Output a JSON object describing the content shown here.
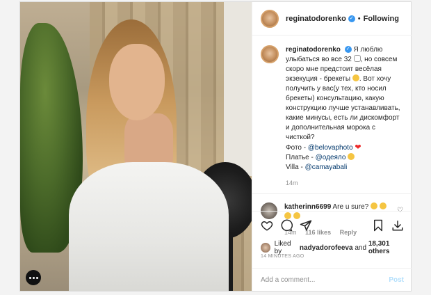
{
  "post": {
    "username": "reginatodorenko",
    "follow_label": "Following",
    "separator": "•",
    "caption": {
      "line1": "Я люблю улыбаться во все 32",
      "line2": ", но совсем скоро мне предстоит весёлая экзекуция - брекеты",
      "line3": ". Вот хочу получить у вас(у тех, кто носил брекеты) консультацию, какую конструкцию лучше устанавливать, какие минусы, есть ли дискомфорт и дополнительная морока с чисткой?",
      "photo_label": "Фото - ",
      "photo_link": "@belovaphoto",
      "dress_label": "Платье - ",
      "dress_link": "@одеяло",
      "villa_label": "Villa - ",
      "villa_link": "@camayabali"
    },
    "caption_time": "14m",
    "comments": [
      {
        "username": "katherinn6699",
        "text": "Are u sure?",
        "time": "14m",
        "likes": "116 likes",
        "reply_label": "Reply"
      }
    ],
    "likes": {
      "prefix": "Liked by ",
      "user": "nadyadorofeeva",
      "middle": " and ",
      "count": "18,301 others"
    },
    "timestamp": "14 MINUTES AGO",
    "comment_input": {
      "placeholder": "Add a comment..."
    },
    "post_label": "Post"
  },
  "icons": [
    "more-icon",
    "verified-icon",
    "heart-icon",
    "comment-icon",
    "share-icon",
    "bookmark-icon",
    "save-download-icon"
  ],
  "colors": {
    "link": "#00376b",
    "verified": "#3897f0",
    "post_disabled": "#b2dffc"
  }
}
